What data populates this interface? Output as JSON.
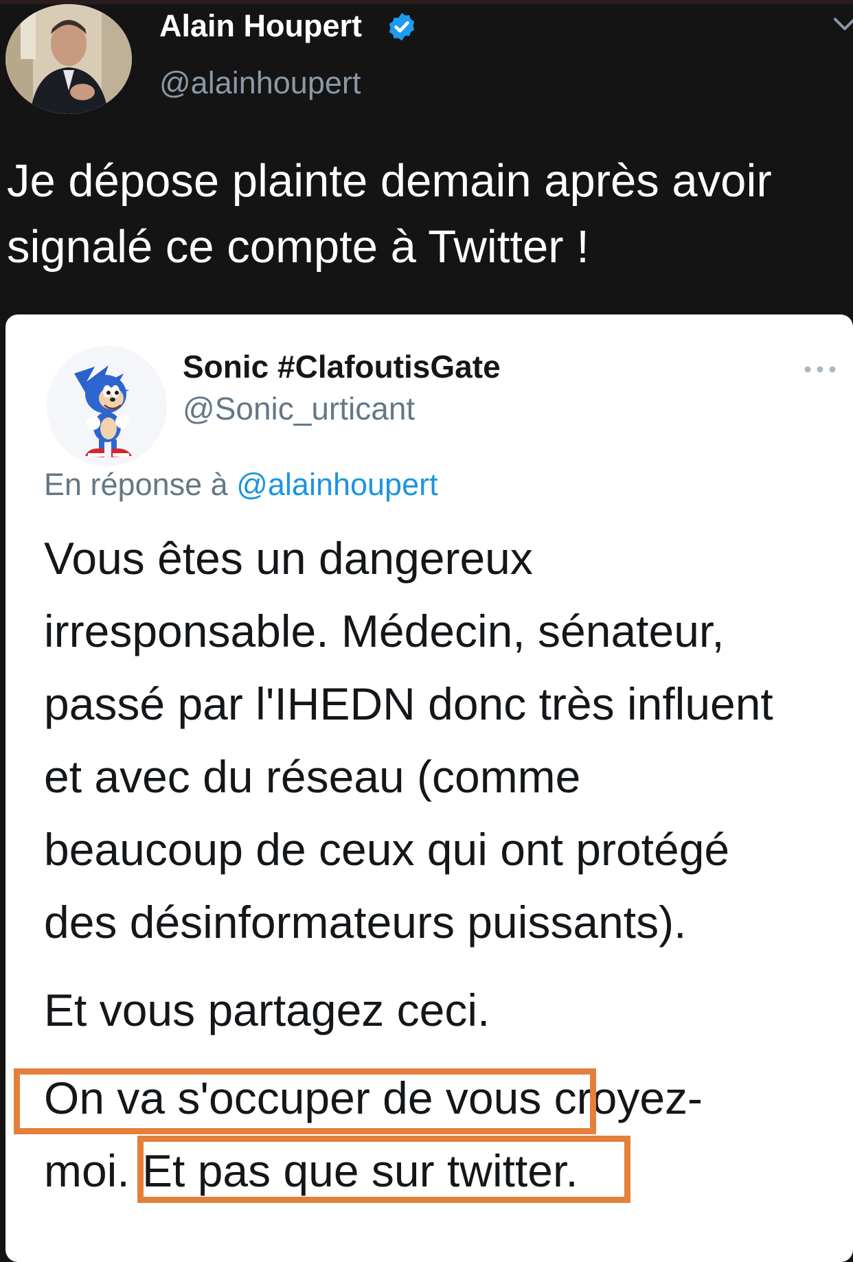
{
  "author": {
    "name": "Alain Houpert",
    "handle": "@alainhoupert",
    "verified": true
  },
  "tweet": {
    "lines": [
      "Je dépose plainte demain après avoir",
      "signalé ce compte à Twitter !"
    ]
  },
  "quoted": {
    "name": "Sonic #ClafoutisGate",
    "handle": "@Sonic_urticant",
    "reply_prefix": "En réponse à",
    "reply_mention": "@alainhoupert",
    "lines": [
      "Vous êtes un dangereux",
      "irresponsable. Médecin, sénateur,",
      "passé par l'IHEDN donc très influent",
      "et avec du réseau (comme",
      "beaucoup de ceux qui ont protégé",
      "des désinformateurs puissants).",
      "Et vous partagez ceci.",
      "On va s'occuper de vous croyez-",
      "moi. Et pas que sur twitter."
    ]
  },
  "colors": {
    "background": "#141414",
    "card": "#ffffff",
    "verified_badge": "#1d9bf0",
    "mention": "#1b95e0",
    "highlight": "#e4803a"
  },
  "icons": [
    "verified-badge-icon",
    "chevron-down-icon",
    "more-options-icon"
  ]
}
